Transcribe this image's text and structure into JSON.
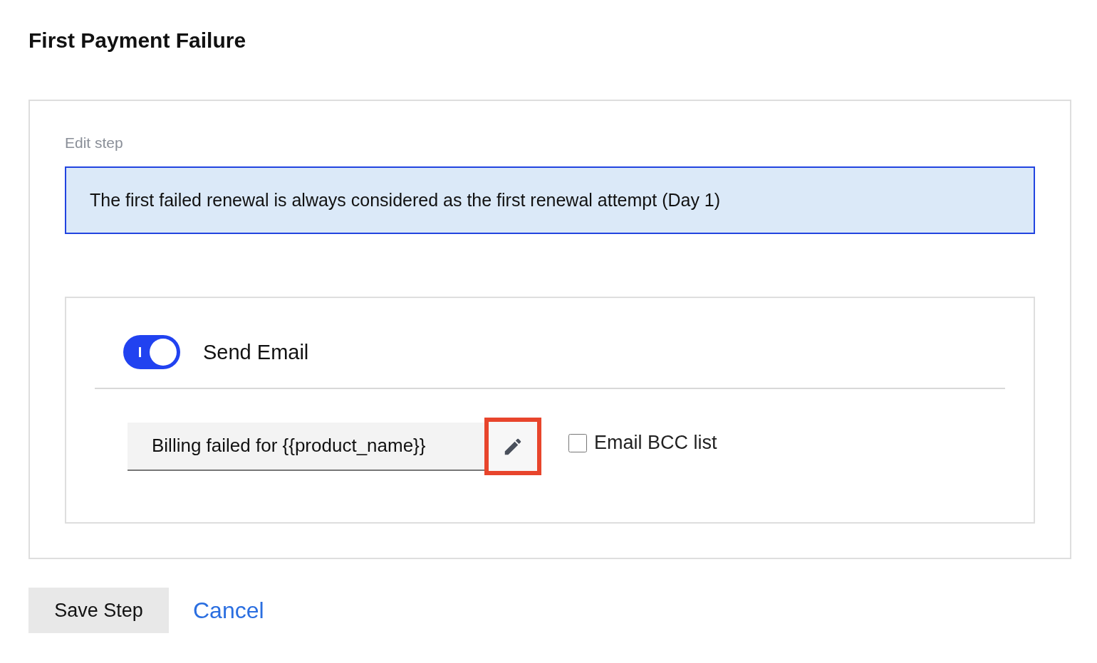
{
  "title": "First Payment Failure",
  "step": {
    "heading": "Edit step",
    "notice": "The first failed renewal is always considered as the first renewal attempt (Day 1)",
    "email": {
      "label": "Send Email",
      "on": true,
      "subject": "Billing failed for {{product_name}}",
      "edit_highlighted": true,
      "bcc": {
        "label": "Email BCC list",
        "checked": false
      }
    }
  },
  "buttons": [
    {
      "kind": "primary",
      "label": "Save Step"
    },
    {
      "kind": "link",
      "label": "Cancel"
    }
  ]
}
